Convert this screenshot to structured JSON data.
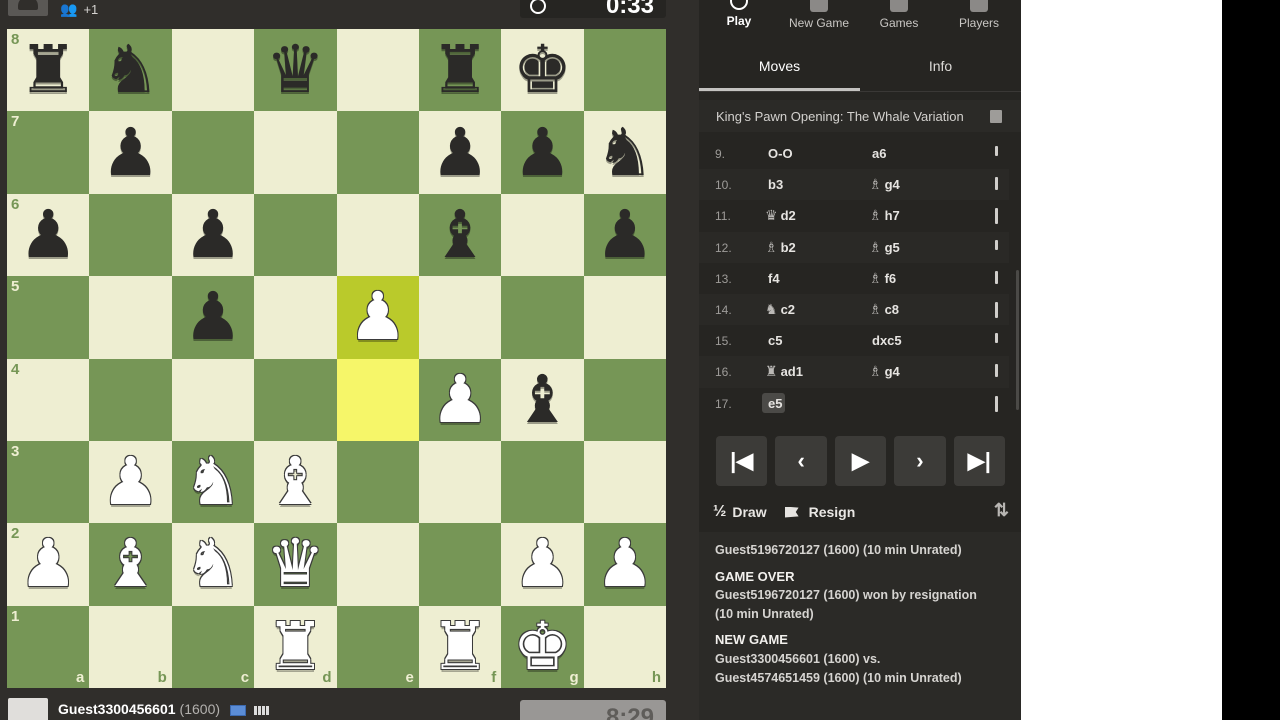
{
  "top_player": {
    "people_icon": "people-icon",
    "extra": "+1",
    "clock": "0:33"
  },
  "board": {
    "ranks": [
      "8",
      "7",
      "6",
      "5",
      "4",
      "3",
      "2",
      "1"
    ],
    "files": [
      "a",
      "b",
      "c",
      "d",
      "e",
      "f",
      "g",
      "h"
    ],
    "squares": [
      [
        "bR",
        "bN",
        "",
        "bQ",
        "",
        "bR",
        "bK",
        ""
      ],
      [
        "",
        "bP",
        "",
        "",
        "",
        "bP",
        "bP",
        "bN"
      ],
      [
        "bP",
        "",
        "bP",
        "",
        "",
        "bB",
        "",
        "bP"
      ],
      [
        "",
        "",
        "bP",
        "",
        "wP",
        "",
        "",
        ""
      ],
      [
        "",
        "",
        "",
        "",
        "",
        "wP",
        "bB",
        ""
      ],
      [
        "",
        "wP",
        "wN",
        "wB",
        "",
        "",
        "",
        ""
      ],
      [
        "wP",
        "wB",
        "wN",
        "wQ",
        "",
        "",
        "wP",
        "wP"
      ],
      [
        "",
        "",
        "",
        "wR",
        "",
        "wR",
        "wK",
        ""
      ]
    ],
    "highlight": [
      "e5",
      "e4"
    ]
  },
  "bottom_player": {
    "name": "Guest3300456601",
    "rating": "(1600)",
    "clock": "8:29"
  },
  "nav": {
    "items": [
      {
        "label": "Play",
        "icon": "play-icon",
        "active": true
      },
      {
        "label": "New Game",
        "icon": "new-game-icon",
        "active": false
      },
      {
        "label": "Games",
        "icon": "games-icon",
        "active": false
      },
      {
        "label": "Players",
        "icon": "players-icon",
        "active": false
      }
    ]
  },
  "tabs": {
    "moves": "Moves",
    "info": "Info"
  },
  "opening": "King's Pawn Opening: The Whale Variation",
  "moves": [
    {
      "num": "9.",
      "w_piece": "",
      "w": "O-O",
      "b_piece": "",
      "b": "a6"
    },
    {
      "num": "10.",
      "w_piece": "",
      "w": "b3",
      "b_piece": "♗",
      "b": "g4"
    },
    {
      "num": "11.",
      "w_piece": "♛",
      "w": "d2",
      "b_piece": "♗",
      "b": "h7"
    },
    {
      "num": "12.",
      "w_piece": "♗",
      "w": "b2",
      "b_piece": "♗",
      "b": "g5"
    },
    {
      "num": "13.",
      "w_piece": "",
      "w": "f4",
      "b_piece": "♗",
      "b": "f6"
    },
    {
      "num": "14.",
      "w_piece": "♞",
      "w": "c2",
      "b_piece": "♗",
      "b": "c8"
    },
    {
      "num": "15.",
      "w_piece": "",
      "w": "c5",
      "b_piece": "",
      "b": "dxc5"
    },
    {
      "num": "16.",
      "w_piece": "♜",
      "w": "ad1",
      "b_piece": "♗",
      "b": "g4"
    },
    {
      "num": "17.",
      "w_piece": "",
      "w": "e5",
      "b_piece": "",
      "b": ""
    }
  ],
  "controls": {
    "first": "|◀",
    "prev": "‹",
    "play": "▶",
    "next": "›",
    "last": "▶|"
  },
  "actions": {
    "draw_icon": "½",
    "draw": "Draw",
    "resign": "Resign"
  },
  "log": {
    "line1": "Guest5196720127 (1600) (10 min Unrated)",
    "game_over_head": "GAME OVER",
    "game_over_1": "Guest5196720127 (1600) won by resignation",
    "game_over_2": "(10 min Unrated)",
    "new_game_head": "NEW GAME",
    "new_game_1": "Guest3300456601 (1600) vs.",
    "new_game_2": "Guest4574651459 (1600) (10 min Unrated)"
  }
}
